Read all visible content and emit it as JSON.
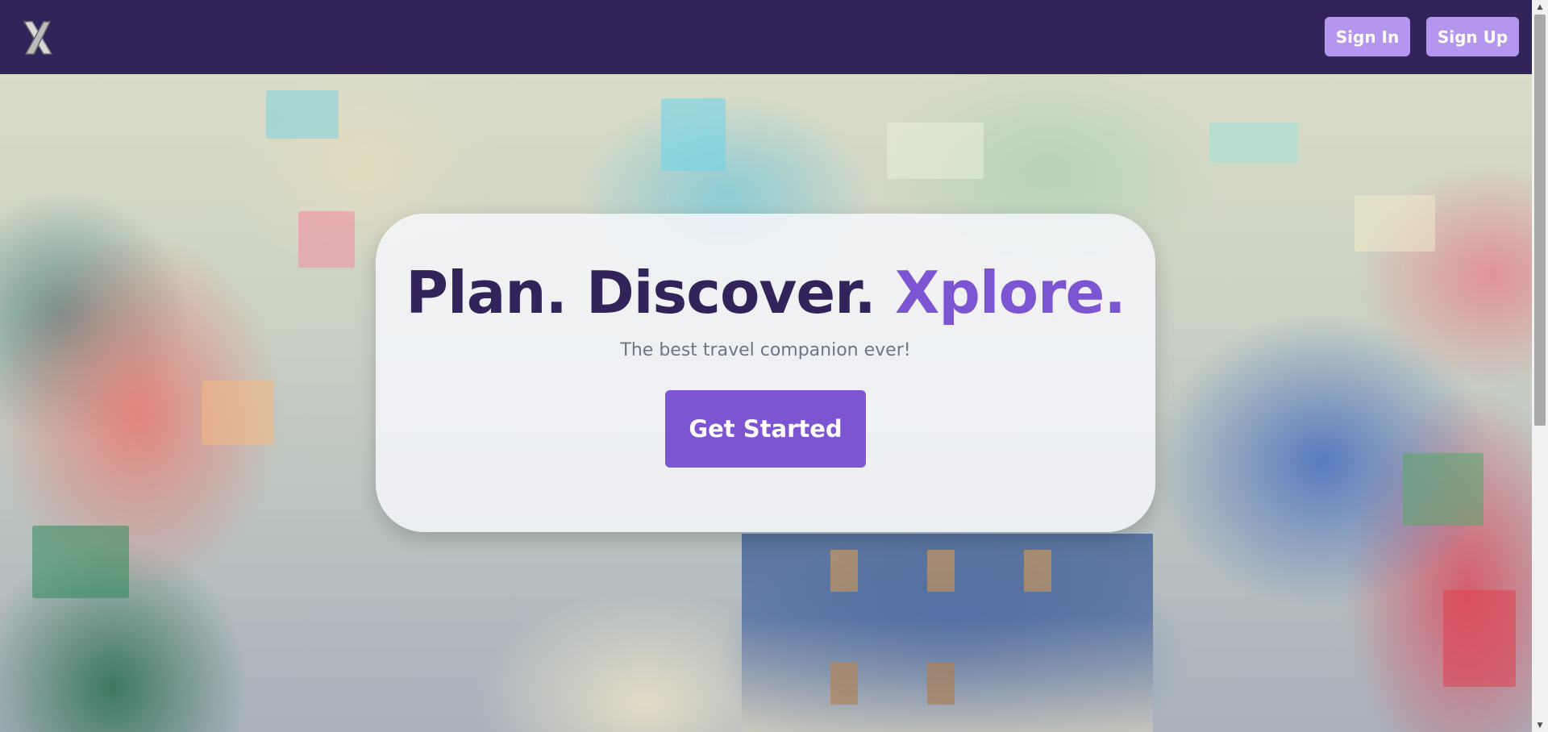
{
  "header": {
    "logo_label": "X",
    "sign_in_label": "Sign In",
    "sign_up_label": "Sign Up"
  },
  "hero": {
    "headline_part1": "Plan. Discover.",
    "headline_accent": "Xplore.",
    "subtitle": "The best travel companion ever!",
    "cta_label": "Get Started"
  },
  "colors": {
    "navbar": "#32245a",
    "nav_button": "#b596ee",
    "accent": "#7d55d3",
    "headline": "#32245a",
    "subtitle": "#6d7683"
  },
  "icons": {
    "logo": "x-logo-icon",
    "scroll_up": "triangle-up-icon",
    "scroll_down": "triangle-down-icon"
  }
}
